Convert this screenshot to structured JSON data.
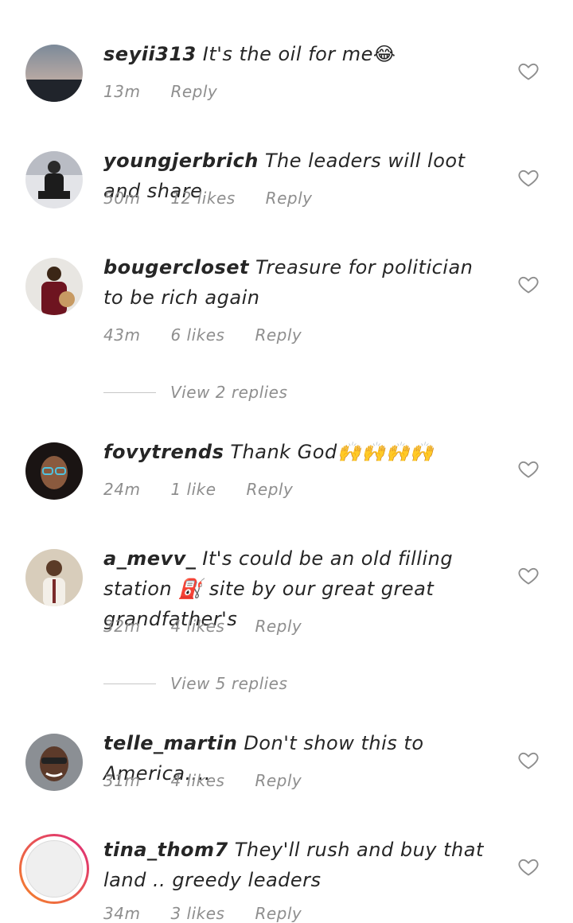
{
  "comments": [
    {
      "username": "seyii313",
      "text": "It's the oil for me😂",
      "time": "13m",
      "likes": "",
      "reply": "Reply"
    },
    {
      "username": "youngjerbrich",
      "text": "The leaders will loot and share",
      "time": "50m",
      "likes": "12 likes",
      "reply": "Reply"
    },
    {
      "username": "bougercloset",
      "text": "Treasure for politician to be rich again",
      "time": "43m",
      "likes": "6 likes",
      "reply": "Reply",
      "view_replies": "View 2 replies"
    },
    {
      "username": "fovytrends",
      "text": "Thank God🙌🙌🙌🙌",
      "time": "24m",
      "likes": "1 like",
      "reply": "Reply"
    },
    {
      "username": "a_mevv_",
      "text": "It's could be an old filling station ⛽ site by our great great grandfather's",
      "time": "32m",
      "likes": "4 likes",
      "reply": "Reply",
      "view_replies": "View 5 replies"
    },
    {
      "username": "telle_martin",
      "text": "Don't show this to America....",
      "time": "31m",
      "likes": "4 likes",
      "reply": "Reply"
    },
    {
      "username": "tina_thom7",
      "text": "They'll rush and buy that land .. greedy leaders",
      "time": "34m",
      "likes": "3 likes",
      "reply": "Reply"
    }
  ],
  "colors": {
    "text": "#262626",
    "muted": "#8e8e8e",
    "story_ring_start": "#f58529",
    "story_ring_end": "#dd2a7b"
  }
}
